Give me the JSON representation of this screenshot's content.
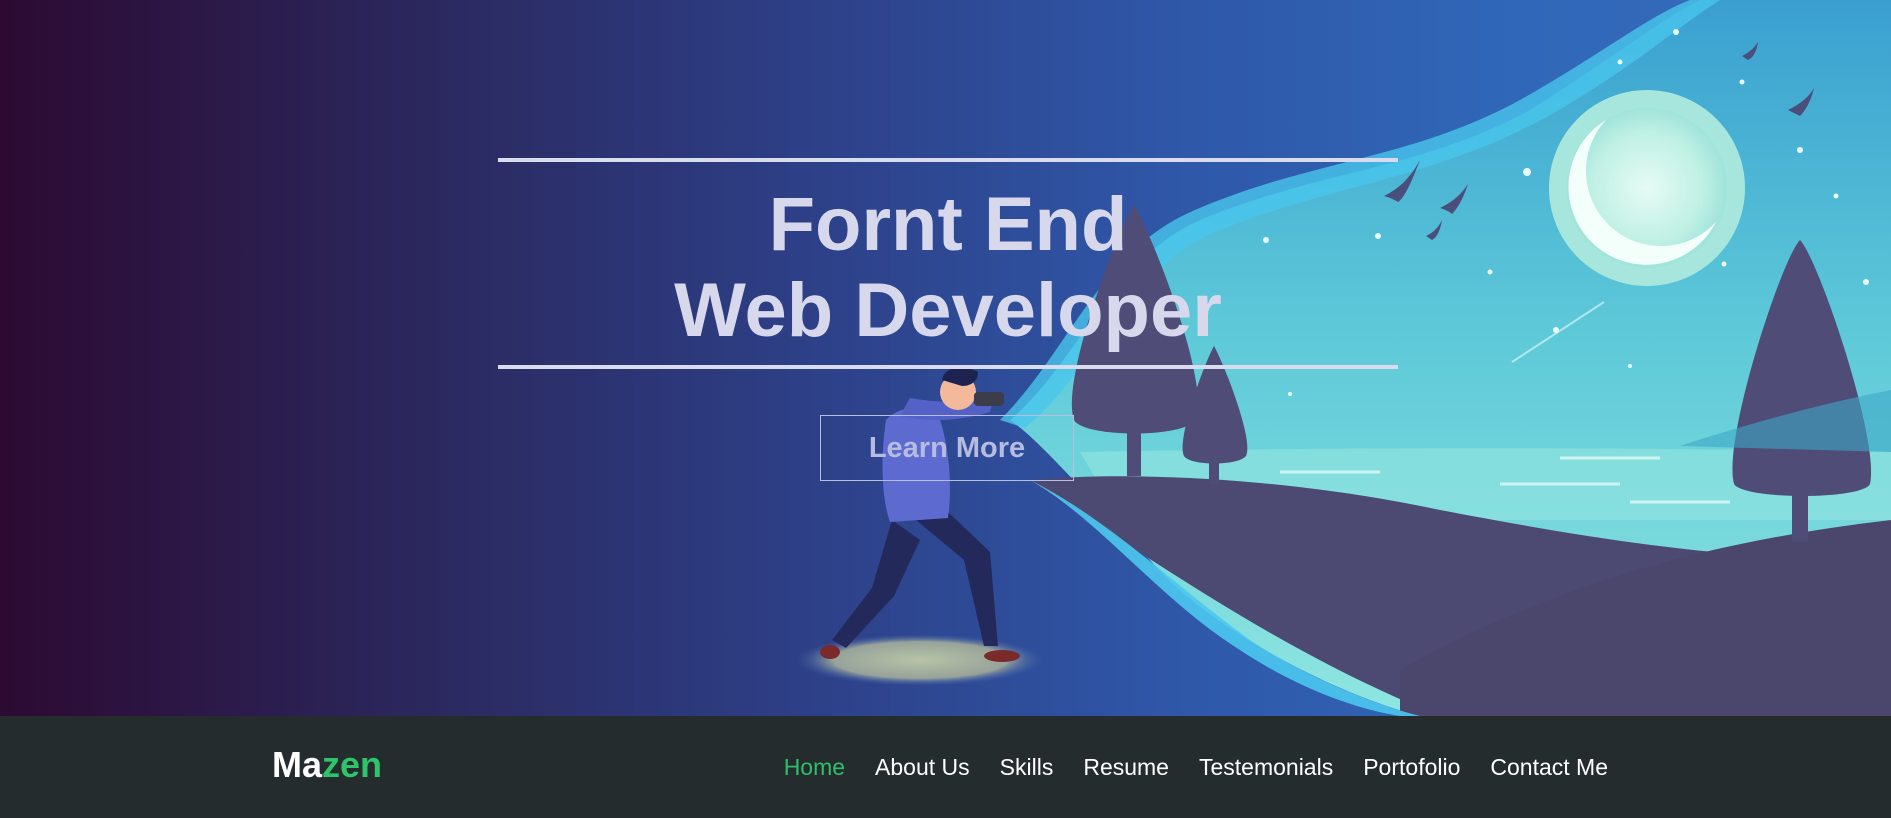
{
  "hero": {
    "title_line1": "Fornt End",
    "title_line2": "Web Developer",
    "button_label": "Learn More"
  },
  "navbar": {
    "logo_part1": "Ma",
    "logo_part2": "zen",
    "items": [
      {
        "label": "Home",
        "active": true
      },
      {
        "label": "About Us"
      },
      {
        "label": "Skills"
      },
      {
        "label": "Resume"
      },
      {
        "label": "Testemonials"
      },
      {
        "label": "Portofolio"
      },
      {
        "label": "Contact Me"
      }
    ]
  },
  "colors": {
    "accent_green": "#2fc46a",
    "navbar_bg": "#252c2e",
    "hero_text": "#d7d8ec"
  }
}
